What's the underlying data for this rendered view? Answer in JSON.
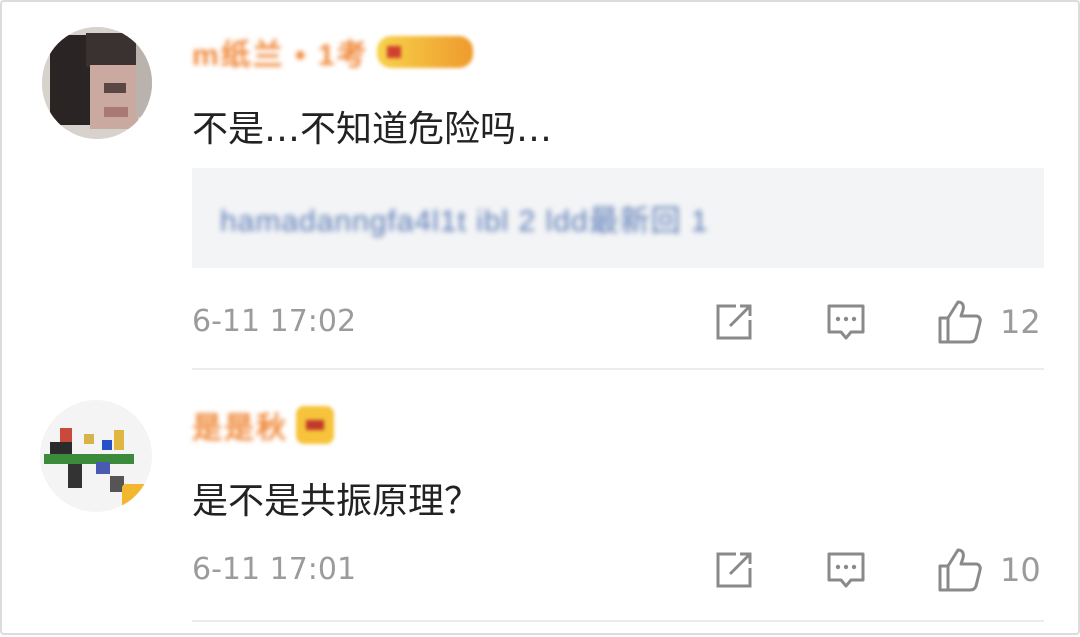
{
  "comments": [
    {
      "username": "m纸兰 • 1考",
      "text": "不是…不知道危险吗…",
      "quoted": "hamadanngfa4l1t ibl 2 ldd最新回 1",
      "time": "6-11 17:02",
      "likes": "12",
      "icons": [
        "share-icon",
        "reply-icon",
        "like-icon"
      ]
    },
    {
      "username": "是是秋",
      "text": "是不是共振原理？",
      "time": "6-11 17:01",
      "likes": "10",
      "icons": [
        "share-icon",
        "reply-icon",
        "like-icon"
      ]
    }
  ],
  "colors": {
    "username": "#f08a3c",
    "meta_text": "#9b9b9b",
    "body_text": "#222222",
    "quote_bg": "#f3f4f6",
    "quote_text": "#5a7bb5"
  }
}
